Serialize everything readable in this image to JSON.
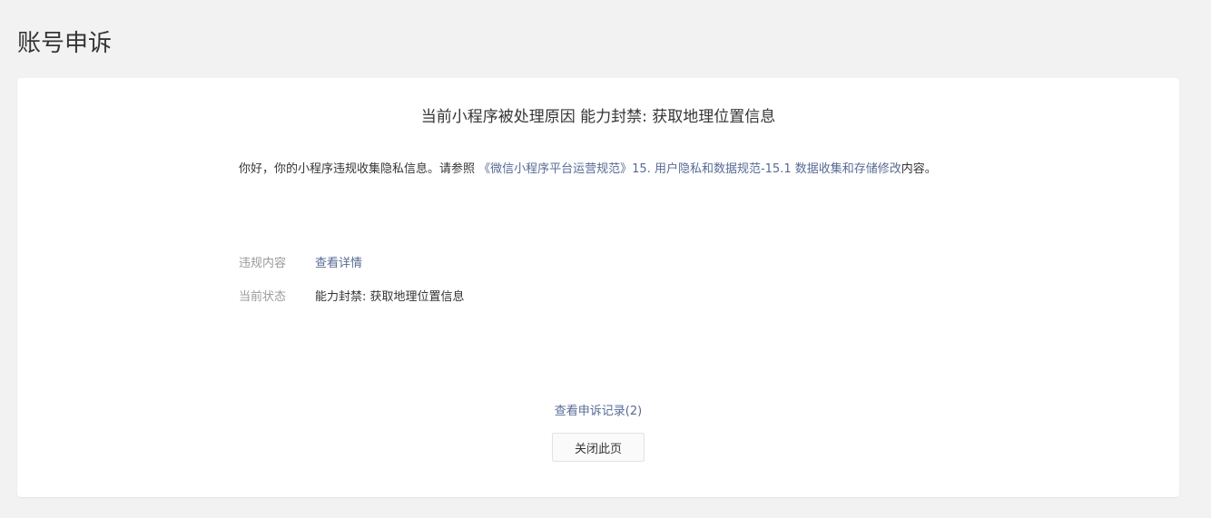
{
  "page": {
    "title": "账号申诉"
  },
  "card": {
    "reason_title": "当前小程序被处理原因 能力封禁: 获取地理位置信息",
    "description": {
      "prefix": "你好，你的小程序违规收集隐私信息。请参照 ",
      "rule_link": "《微信小程序平台运营规范》15. 用户隐私和数据规范-15.1 数据收集和存储修改",
      "suffix": "内容。"
    },
    "violation": {
      "label": "违规内容",
      "value": "查看详情"
    },
    "status": {
      "label": "当前状态",
      "value": "能力封禁: 获取地理位置信息"
    },
    "appeal_records_link": "查看申诉记录(2)",
    "close_button_label": "关闭此页"
  },
  "colors": {
    "background": "#f2f2f2",
    "card": "#ffffff",
    "link": "#576b95",
    "text": "#353535",
    "muted": "#9a9a9a"
  }
}
